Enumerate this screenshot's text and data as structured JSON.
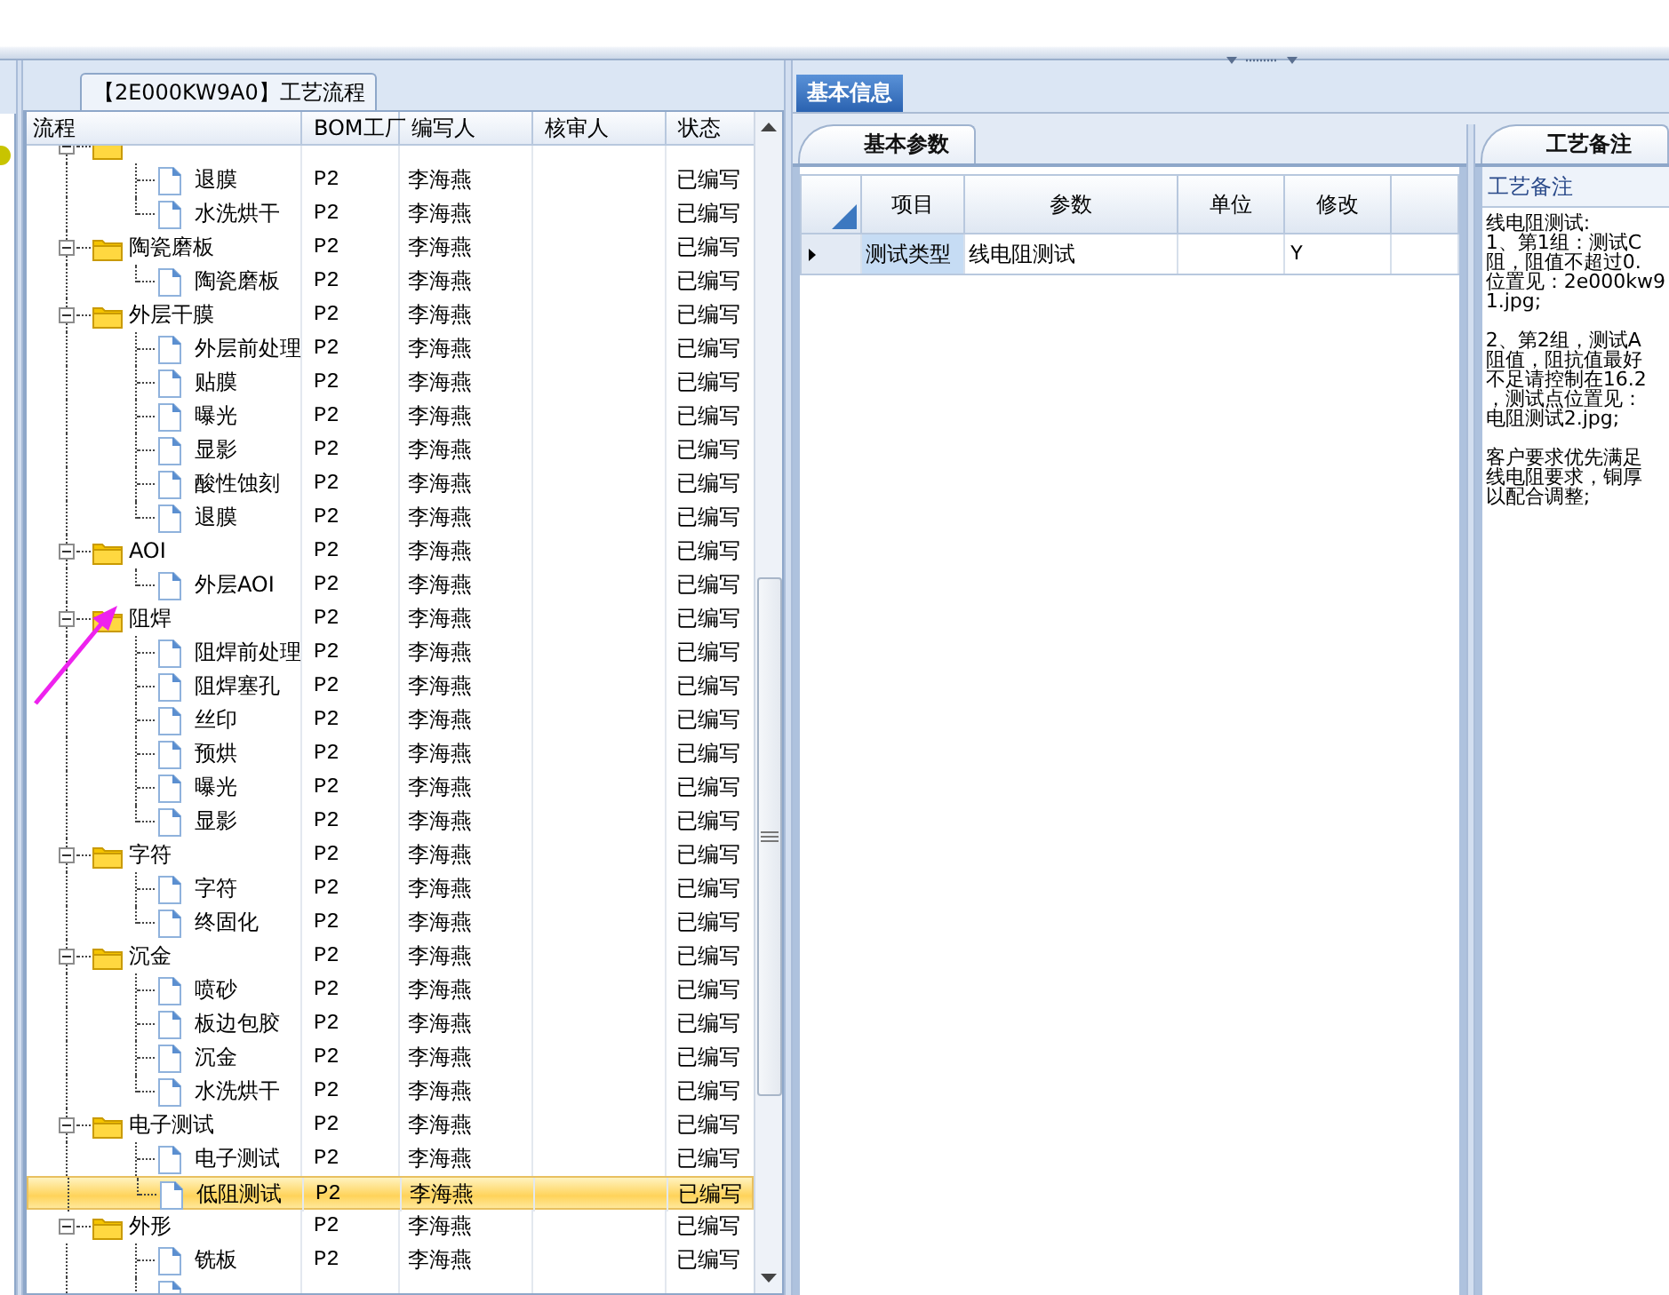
{
  "process_panel": {
    "title": "【2E000KW9A0】工艺流程"
  },
  "tree": {
    "columns": [
      "流程",
      "BOM工厂",
      "编写人",
      "核审人",
      "状态"
    ],
    "nodes": [
      {
        "expanded": true,
        "selected": false,
        "children": [
          {
            "label": "退膜",
            "bom": "P2",
            "writer": "李海燕",
            "status": "已编写",
            "selected": false
          },
          {
            "label": "水洗烘干",
            "bom": "P2",
            "writer": "李海燕",
            "status": "已编写",
            "selected": false
          }
        ]
      },
      {
        "label": "陶瓷磨板",
        "bom": "P2",
        "writer": "李海燕",
        "status": "已编写",
        "expanded": true,
        "selected": false,
        "children": [
          {
            "label": "陶瓷磨板",
            "bom": "P2",
            "writer": "李海燕",
            "status": "已编写",
            "selected": false
          }
        ]
      },
      {
        "label": "外层干膜",
        "bom": "P2",
        "writer": "李海燕",
        "status": "已编写",
        "expanded": true,
        "selected": false,
        "children": [
          {
            "label": "外层前处理",
            "bom": "P2",
            "writer": "李海燕",
            "status": "已编写",
            "selected": false
          },
          {
            "label": "贴膜",
            "bom": "P2",
            "writer": "李海燕",
            "status": "已编写",
            "selected": false
          },
          {
            "label": "曝光",
            "bom": "P2",
            "writer": "李海燕",
            "status": "已编写",
            "selected": false
          },
          {
            "label": "显影",
            "bom": "P2",
            "writer": "李海燕",
            "status": "已编写",
            "selected": false
          },
          {
            "label": "酸性蚀刻",
            "bom": "P2",
            "writer": "李海燕",
            "status": "已编写",
            "selected": false
          },
          {
            "label": "退膜",
            "bom": "P2",
            "writer": "李海燕",
            "status": "已编写",
            "selected": false
          }
        ]
      },
      {
        "label": "AOI",
        "bom": "P2",
        "writer": "李海燕",
        "status": "已编写",
        "expanded": true,
        "selected": false,
        "children": [
          {
            "label": "外层AOI",
            "bom": "P2",
            "writer": "李海燕",
            "status": "已编写",
            "selected": false
          }
        ]
      },
      {
        "label": "阻焊",
        "bom": "P2",
        "writer": "李海燕",
        "status": "已编写",
        "expanded": true,
        "selected": false,
        "children": [
          {
            "label": "阻焊前处理",
            "bom": "P2",
            "writer": "李海燕",
            "status": "已编写",
            "selected": false
          },
          {
            "label": "阻焊塞孔",
            "bom": "P2",
            "writer": "李海燕",
            "status": "已编写",
            "selected": false
          },
          {
            "label": "丝印",
            "bom": "P2",
            "writer": "李海燕",
            "status": "已编写",
            "selected": false
          },
          {
            "label": "预烘",
            "bom": "P2",
            "writer": "李海燕",
            "status": "已编写",
            "selected": false
          },
          {
            "label": "曝光",
            "bom": "P2",
            "writer": "李海燕",
            "status": "已编写",
            "selected": false
          },
          {
            "label": "显影",
            "bom": "P2",
            "writer": "李海燕",
            "status": "已编写",
            "selected": false
          }
        ]
      },
      {
        "label": "字符",
        "bom": "P2",
        "writer": "李海燕",
        "status": "已编写",
        "expanded": true,
        "selected": false,
        "children": [
          {
            "label": "字符",
            "bom": "P2",
            "writer": "李海燕",
            "status": "已编写",
            "selected": false
          },
          {
            "label": "终固化",
            "bom": "P2",
            "writer": "李海燕",
            "status": "已编写",
            "selected": false
          }
        ]
      },
      {
        "label": "沉金",
        "bom": "P2",
        "writer": "李海燕",
        "status": "已编写",
        "expanded": true,
        "selected": false,
        "children": [
          {
            "label": "喷砂",
            "bom": "P2",
            "writer": "李海燕",
            "status": "已编写",
            "selected": false
          },
          {
            "label": "板边包胶",
            "bom": "P2",
            "writer": "李海燕",
            "status": "已编写",
            "selected": false
          },
          {
            "label": "沉金",
            "bom": "P2",
            "writer": "李海燕",
            "status": "已编写",
            "selected": false
          },
          {
            "label": "水洗烘干",
            "bom": "P2",
            "writer": "李海燕",
            "status": "已编写",
            "selected": false
          }
        ]
      },
      {
        "label": "电子测试",
        "bom": "P2",
        "writer": "李海燕",
        "status": "已编写",
        "expanded": true,
        "selected": false,
        "children": [
          {
            "label": "电子测试",
            "bom": "P2",
            "writer": "李海燕",
            "status": "已编写",
            "selected": false
          },
          {
            "label": "低阻测试",
            "bom": "P2",
            "writer": "李海燕",
            "status": "已编写",
            "selected": true
          }
        ]
      },
      {
        "label": "外形",
        "bom": "P2",
        "writer": "李海燕",
        "status": "已编写",
        "expanded": true,
        "selected": false,
        "children": [
          {
            "label": "铣板",
            "bom": "P2",
            "writer": "李海燕",
            "status": "已编写",
            "selected": false
          },
          {
            "selected": false
          }
        ]
      }
    ]
  },
  "info_tabs": [
    {
      "label": "基本信息",
      "selected": true
    }
  ],
  "param_tabs": [
    {
      "label": "基本参数",
      "selected": true
    }
  ],
  "params": {
    "columns": [
      "项目",
      "参数",
      "单位",
      "修改"
    ],
    "rows": [
      {
        "item": "测试类型",
        "value": "线电阻测试",
        "modified": "Y",
        "current": true
      }
    ]
  },
  "notes_tabs": [
    {
      "label": "工艺备注",
      "selected": true
    }
  ],
  "notes": {
    "label": "工艺备注",
    "paragraphs": [
      [
        "线电阻测试:",
        "1、第1组：测试C",
        "阻，阻值不超过0.",
        "位置见：2e000kw9",
        "1.jpg;"
      ],
      [
        "2、第2组，测试A",
        "阻值，阻抗值最好",
        "不足请控制在16.2",
        "，测试点位置见：",
        "电阻测试2.jpg;"
      ],
      [
        "客户要求优先满足",
        "线电阻要求，铜厚",
        "以配合调整;"
      ]
    ]
  }
}
